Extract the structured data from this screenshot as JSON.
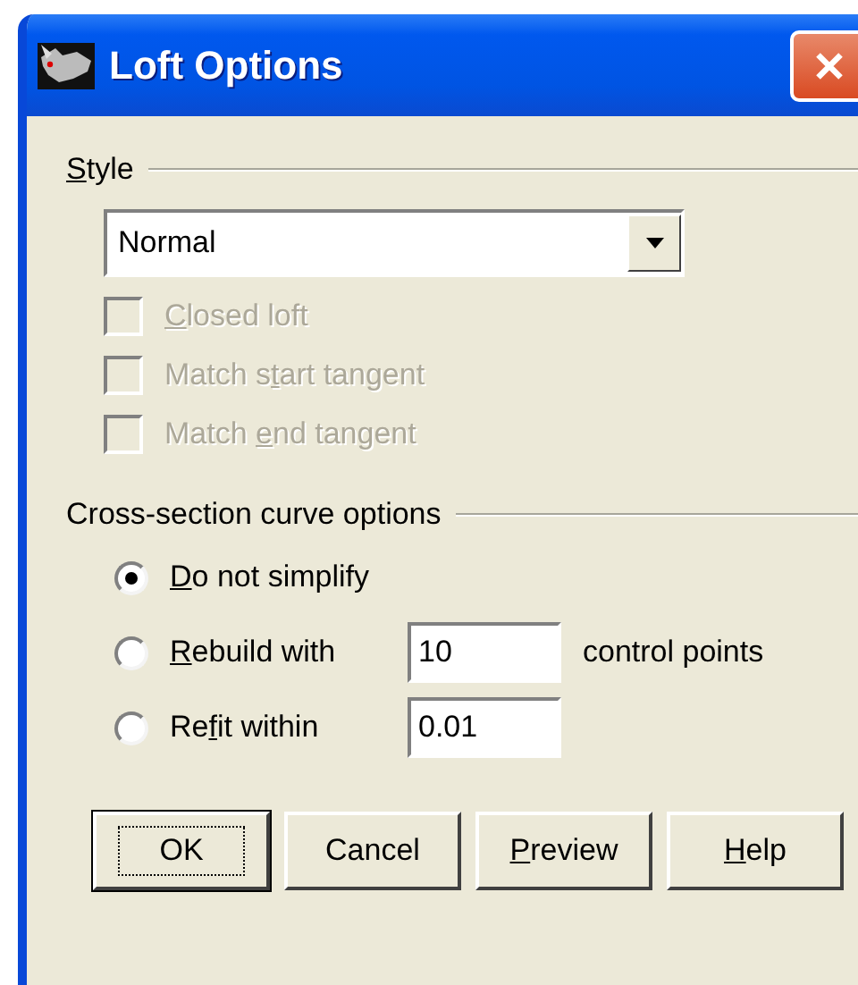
{
  "window": {
    "title": "Loft Options"
  },
  "style_group": {
    "label": {
      "key": "S",
      "after": "tyle"
    },
    "dropdown": {
      "value": "Normal"
    },
    "options": [
      {
        "label": {
          "key": "C",
          "after": "losed loft"
        },
        "checked": false,
        "disabled": true
      },
      {
        "label": {
          "before": "Match s",
          "key": "t",
          "after": "art tangent"
        },
        "checked": false,
        "disabled": true
      },
      {
        "label": {
          "before": "Match ",
          "key": "e",
          "after": "nd tangent"
        },
        "checked": false,
        "disabled": true
      }
    ]
  },
  "curve_group": {
    "label": "Cross-section curve options",
    "options": [
      {
        "kind": "plain",
        "label": {
          "key": "D",
          "after": "o not simplify"
        },
        "selected": true
      },
      {
        "kind": "field",
        "label": {
          "key": "R",
          "after": "ebuild with"
        },
        "selected": false,
        "value": "10",
        "suffix": "control points"
      },
      {
        "kind": "field",
        "label": {
          "before": "Re",
          "key": "f",
          "after": "it within"
        },
        "selected": false,
        "value": "0.01"
      }
    ]
  },
  "buttons": [
    {
      "label": {
        "before": "OK"
      },
      "default": true
    },
    {
      "label": {
        "before": "Cancel"
      },
      "default": false
    },
    {
      "label": {
        "key": "P",
        "after": "review"
      },
      "default": false
    },
    {
      "label": {
        "key": "H",
        "after": "elp"
      },
      "default": false
    }
  ]
}
